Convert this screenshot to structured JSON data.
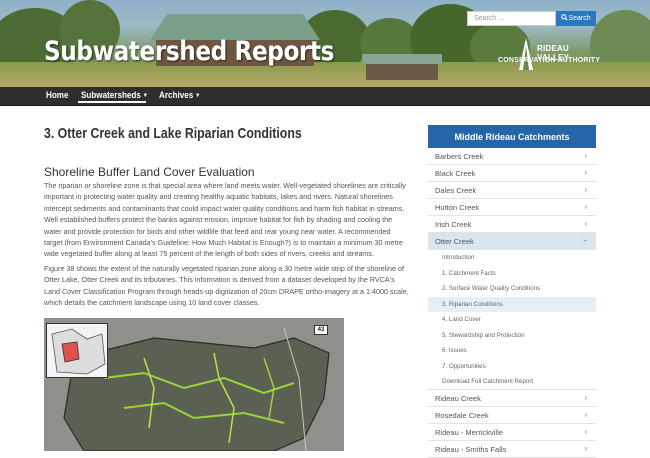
{
  "header": {
    "site_title": "Subwatershed Reports",
    "search_placeholder": "Search ...",
    "search_button": "Search",
    "logo_line1": "RIDEAU VALLEY",
    "logo_line2": "CONSERVATION AUTHORITY"
  },
  "nav": {
    "items": [
      {
        "label": "Home"
      },
      {
        "label": "Subwatersheds"
      },
      {
        "label": "Archives"
      }
    ]
  },
  "main": {
    "page_title": "3. Otter Creek and Lake Riparian Conditions",
    "section_title": "Shoreline Buffer Land Cover Evaluation",
    "paragraph1": "The riparian or shoreline zone is that special area where land meets water. Well-vegetated shorelines are critically important in protecting water quality and creating healthy aquatic habitats, lakes and rivers. Natural shorelines intercept sediments and contaminants that could impact water quality conditions and harm fish habitat in streams. Well established buffers protect the banks against erosion, improve habitat for fish by shading and cooling the water and provide protection for birds and other wildlife that feed and rear young near water. A recommended target (from Environment Canada's Guideline: How Much Habitat is Enough?) is to maintain a minimum 30 metre wide vegetated buffer along at least 75 percent of the length of both sides of rivers, creeks and streams.",
    "paragraph2": "Figure 38 shows the extent of the naturally vegetated riparian zone along a 30 metre wide strip of the shoreline of Otter Lake, Otter Creek and its tributaries. This information is derived from a dataset developed by the RVCA's Land Cover Classification Program through heads-up digitization of 20cm DRAPE ortho-imagery at a 1:4000 scale, which details the catchment landscape using 10 land cover classes.",
    "map_marker": "43"
  },
  "sidebar": {
    "title": "Middle Rideau Catchments",
    "items_top": [
      {
        "label": "Barbers Creek"
      },
      {
        "label": "Black Creek"
      },
      {
        "label": "Dales Creek"
      },
      {
        "label": "Hutton Creek"
      },
      {
        "label": "Irish Creek"
      },
      {
        "label": "Otter Creek"
      }
    ],
    "subitems": [
      {
        "label": "Introduction"
      },
      {
        "label": "1. Catchment Facts"
      },
      {
        "label": "2. Surface Water Quality Conditions"
      },
      {
        "label": "3. Riparian Conditions"
      },
      {
        "label": "4. Land Cover"
      },
      {
        "label": "5. Stewardship and Protection"
      },
      {
        "label": "6. Issues"
      },
      {
        "label": "7. Opportunities"
      },
      {
        "label": "Download Full Catchment Report"
      }
    ],
    "items_bottom": [
      {
        "label": "Rideau Creek"
      },
      {
        "label": "Rosedale Creek"
      },
      {
        "label": "Rideau - Merrickville"
      },
      {
        "label": "Rideau - Smiths Falls"
      }
    ]
  }
}
